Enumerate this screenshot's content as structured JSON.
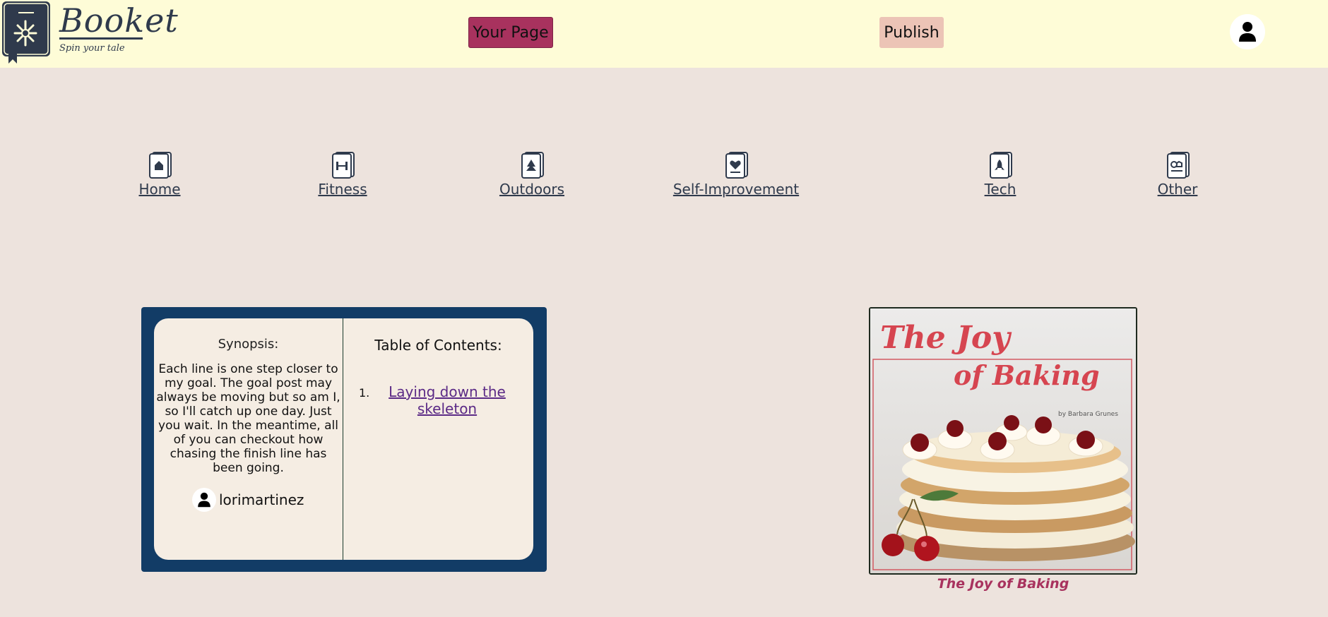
{
  "header": {
    "logo_title": "Booket",
    "logo_tagline": "Spin your tale",
    "your_page_label": "Your Page",
    "publish_label": "Publish",
    "profile_icon": "user-icon"
  },
  "categories": [
    {
      "label": "Home",
      "icon": "book-home-icon"
    },
    {
      "label": "Fitness",
      "icon": "book-dumbbell-icon"
    },
    {
      "label": "Outdoors",
      "icon": "book-tree-icon"
    },
    {
      "label": "Self-Improvement",
      "icon": "book-heart-icon"
    },
    {
      "label": "Tech",
      "icon": "book-rocket-icon"
    },
    {
      "label": "Other",
      "icon": "book-misc-icon"
    }
  ],
  "book": {
    "synopsis_title": "Synopsis:",
    "synopsis_text": "Each line is one step closer to my goal. The goal post may always be moving but so am I, so I'll catch up one day. Just you wait. In the meantime, all of you can checkout how chasing the finish line has been going.",
    "author": "lorimartinez",
    "toc_title": "Table of Contents:",
    "toc": [
      {
        "number": "1.",
        "title": "Laying down the skeleton"
      }
    ]
  },
  "cover": {
    "title_line1": "The Joy",
    "title_line2": "of Baking",
    "byline": "by Barbara Grunes",
    "caption": "The Joy of Baking"
  },
  "colors": {
    "background": "#ede3dd",
    "header": "#fefcd7",
    "accent": "#a8325e",
    "publish": "#ecc4b6",
    "navy": "#123c66",
    "link": "#5b2a86"
  }
}
